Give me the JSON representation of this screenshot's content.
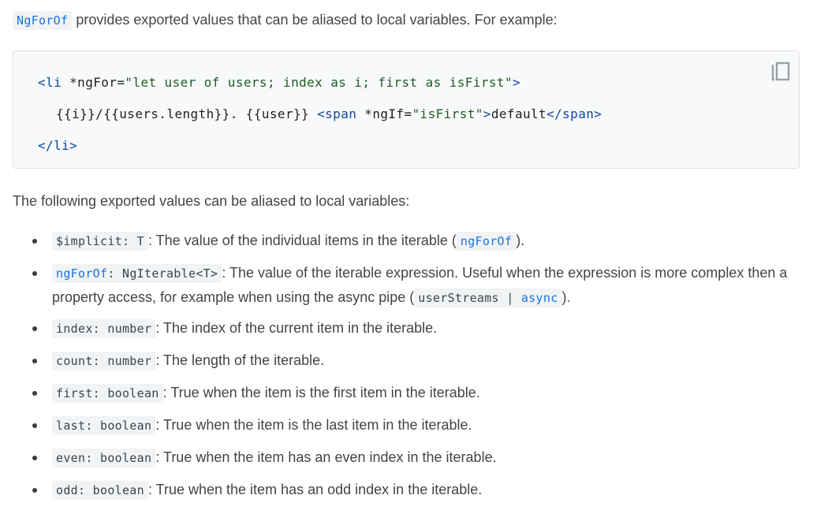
{
  "intro": {
    "code": "NgForOf",
    "text": " provides exported values that can be aliased to local variables. For example:"
  },
  "codeblock": {
    "copy_icon": "copy-icon",
    "line1": {
      "open": "<li ",
      "attr": "*ngFor=",
      "value": "\"let user of users; index as i; first as isFirst\"",
      "close": ">"
    },
    "line2": {
      "text": "{{i}}/{{users.length}}. {{user}} ",
      "span_open": "<span ",
      "attr": "*ngIf=",
      "value": "\"isFirst\"",
      "gt": ">",
      "content": "default",
      "span_close": "</span>"
    },
    "line3": "</li>"
  },
  "following": "The following exported values can be aliased to local variables:",
  "items": [
    {
      "code": "$implicit: T",
      "desc": ": The value of the individual items in the iterable (",
      "code2": "ngForOf",
      "desc2": ")."
    },
    {
      "code_a": "ngForOf",
      "code_b": ": NgIterable",
      "code_c": "<T>",
      "desc": ": The value of the iterable expression. Useful when the expression is more complex then a property access, for example when using the async pipe (",
      "code2_a": "userStreams | ",
      "code2_b": "async",
      "desc2": ")."
    },
    {
      "code": "index: number",
      "desc": ": The index of the current item in the iterable."
    },
    {
      "code": "count: number",
      "desc": ": The length of the iterable."
    },
    {
      "code": "first: boolean",
      "desc": ": True when the item is the first item in the iterable."
    },
    {
      "code": "last: boolean",
      "desc": ": True when the item is the last item in the iterable."
    },
    {
      "code": "even: boolean",
      "desc": ": True when the item has an even index in the iterable."
    },
    {
      "code": "odd: boolean",
      "desc": ": True when the item has an odd index in the iterable."
    }
  ],
  "colors": {
    "link_blue": "#1a73e8",
    "code_bg": "#f1f3f4",
    "text": "#444444"
  }
}
